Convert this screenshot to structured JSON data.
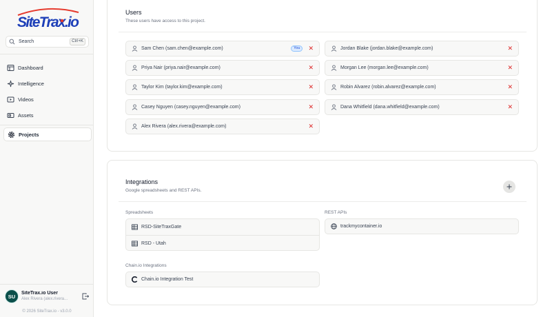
{
  "sidebar": {
    "logo_text": "SiteTrax.io",
    "search": {
      "label": "Search",
      "shortcut": "Ctrl+K"
    },
    "nav": [
      {
        "label": "Dashboard",
        "icon": "dashboard-icon"
      },
      {
        "label": "Intelligence",
        "icon": "sparkle-icon"
      },
      {
        "label": "Videos",
        "icon": "video-icon"
      },
      {
        "label": "Assets",
        "icon": "assets-icon"
      },
      {
        "label": "Projects",
        "icon": "gear-icon",
        "active": true
      }
    ],
    "user": {
      "initials": "SU",
      "name": "SiteTrax.io User",
      "sub": "Alex Rivera (alex.rivera..."
    },
    "copyright": "© 2026 SiteTrax.io - v3.0.0"
  },
  "users": {
    "title": "Users",
    "subtitle": "These users have access to this project.",
    "you_badge": "You",
    "remove_glyph": "✕",
    "left": [
      "Sam Chen (sam.chen@example.com)",
      "Priya Nair (priya.nair@example.com)",
      "Taylor Kim (taylor.kim@example.com)",
      "Casey Nguyen (casey.nguyen@example.com)",
      "Alex Rivera (alex.rivera@example.com)"
    ],
    "right": [
      "Jordan Blake (jordan.blake@example.com)",
      "Morgan Lee (morgan.lee@example.com)",
      "Robin Alvarez (robin.alvarez@example.com)",
      "Dana Whitfield (dana.whitfield@example.com)"
    ]
  },
  "integrations": {
    "title": "Integrations",
    "subtitle": "Google spreadsheets and REST APIs.",
    "spreadsheets_label": "Spreadsheets",
    "spreadsheets": [
      "RSD-SiteTraxGate",
      "RSD - Utah"
    ],
    "rest_label": "REST APIs",
    "rest": [
      "trackmycontainer.io"
    ],
    "chain_label": "Chain.io Integrations",
    "chain": [
      "Chain.io Integration Test"
    ]
  },
  "colors": {
    "accent": "#0b4f4a",
    "logo_blue": "#1d3fb8",
    "remove_red": "#dc2626"
  }
}
